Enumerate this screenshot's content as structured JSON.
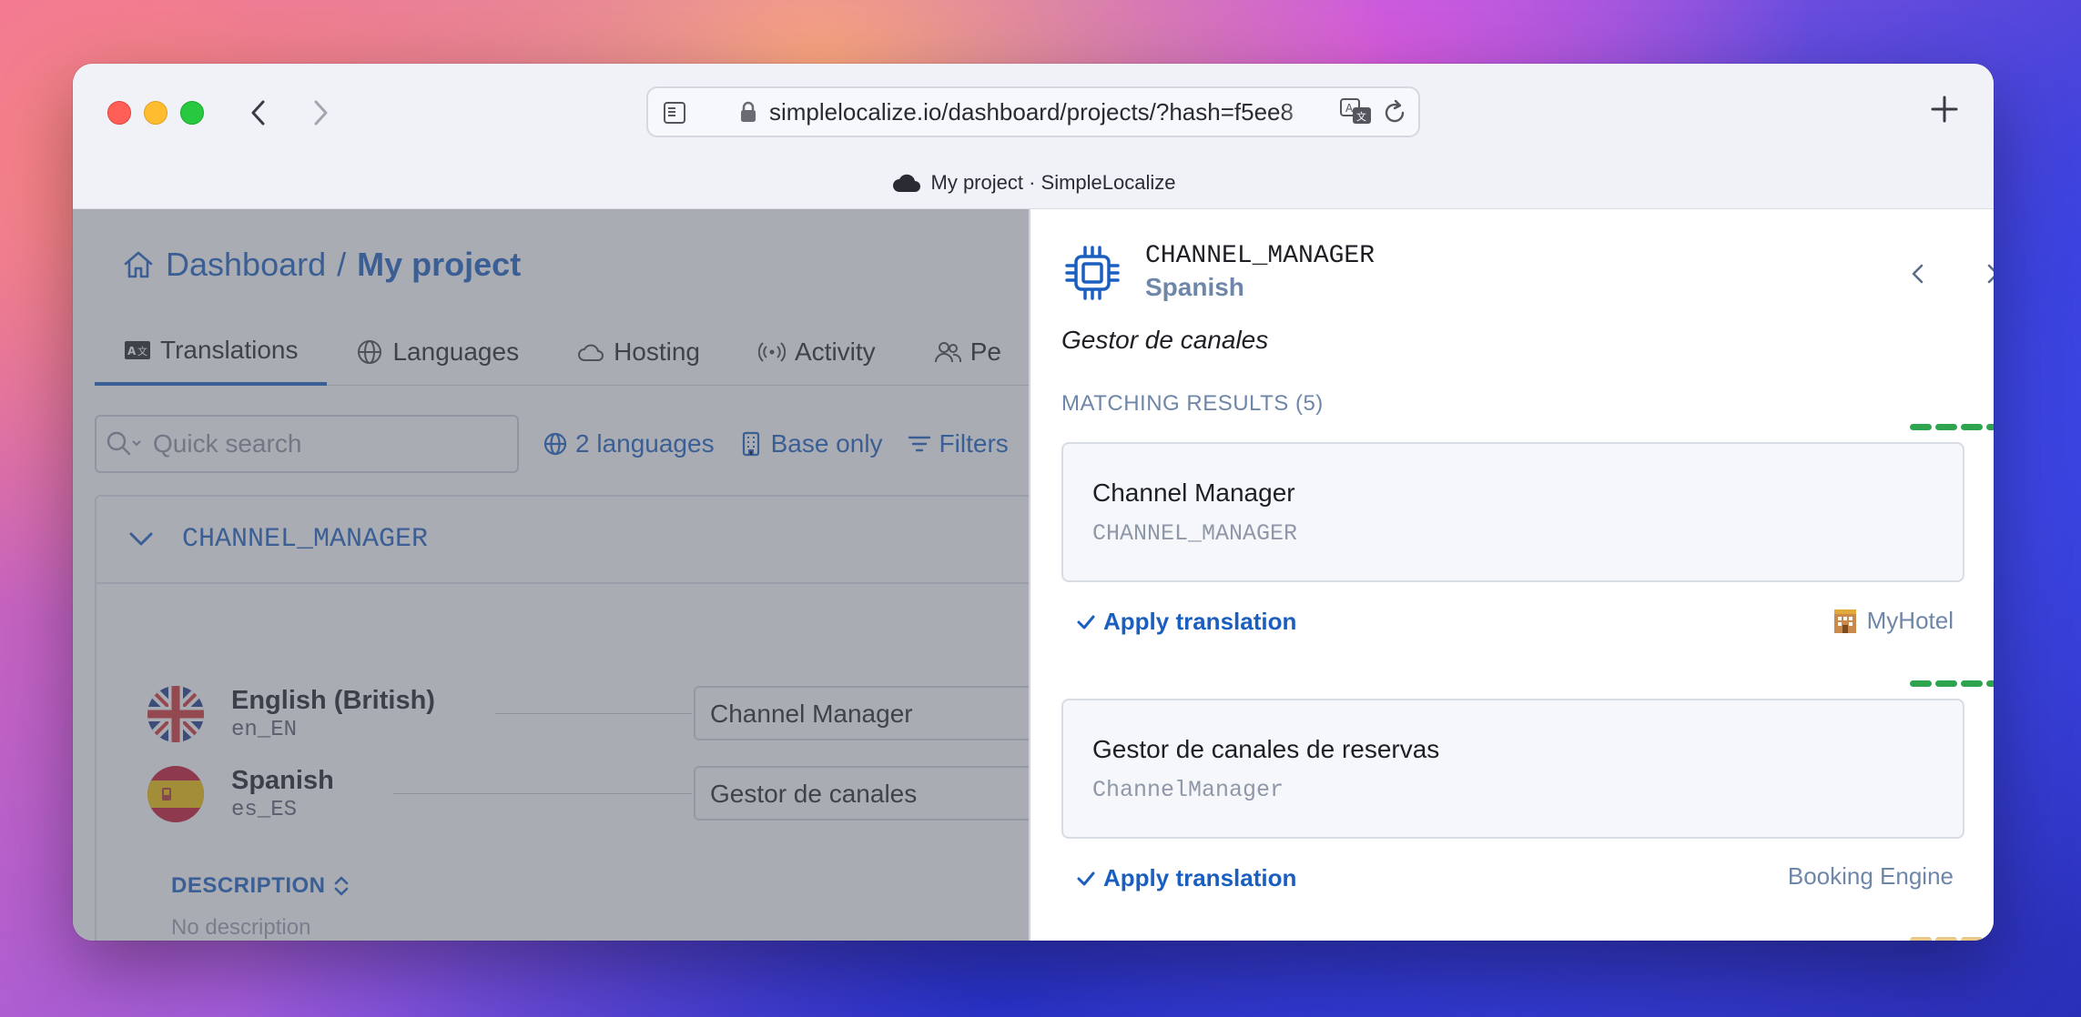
{
  "browser": {
    "url": "simplelocalize.io/dashboard/projects/?hash=f5ee8",
    "tab_title": "My project · SimpleLocalize"
  },
  "left": {
    "breadcrumb": {
      "root": "Dashboard",
      "separator": "/",
      "current": "My project"
    },
    "tabs": [
      {
        "label": "Translations",
        "icon": "translate-icon",
        "active": true
      },
      {
        "label": "Languages",
        "icon": "globe-icon"
      },
      {
        "label": "Hosting",
        "icon": "cloud-icon"
      },
      {
        "label": "Activity",
        "icon": "broadcast-icon"
      },
      {
        "label": "Pe",
        "icon": "people-icon"
      }
    ],
    "search_placeholder": "Quick search",
    "filters": {
      "languages": "2 languages",
      "base": "Base only",
      "filters": "Filters"
    },
    "key": "CHANNEL_MANAGER",
    "languages": [
      {
        "name": "English (British)",
        "code": "en_EN",
        "value": "Channel Manager",
        "flag": "uk-flag"
      },
      {
        "name": "Spanish",
        "code": "es_ES",
        "value": "Gestor de canales",
        "flag": "spain-flag"
      }
    ],
    "description_label": "DESCRIPTION",
    "no_description": "No description"
  },
  "panel": {
    "key": "CHANNEL_MANAGER",
    "language": "Spanish",
    "value": "Gestor de canales",
    "section_title": "MATCHING RESULTS (5)",
    "apply_label": "Apply translation",
    "results": [
      {
        "text": "Channel Manager",
        "key": "CHANNEL_MANAGER",
        "source": "MyHotel",
        "quality": 5
      },
      {
        "text": "Gestor de canales de reservas",
        "key": "ChannelManager",
        "source": "Booking Engine",
        "quality": 4
      }
    ]
  },
  "colors": {
    "accent": "#1a5fbf",
    "quality": "#2ea44f",
    "muted": "#6e86a8"
  }
}
